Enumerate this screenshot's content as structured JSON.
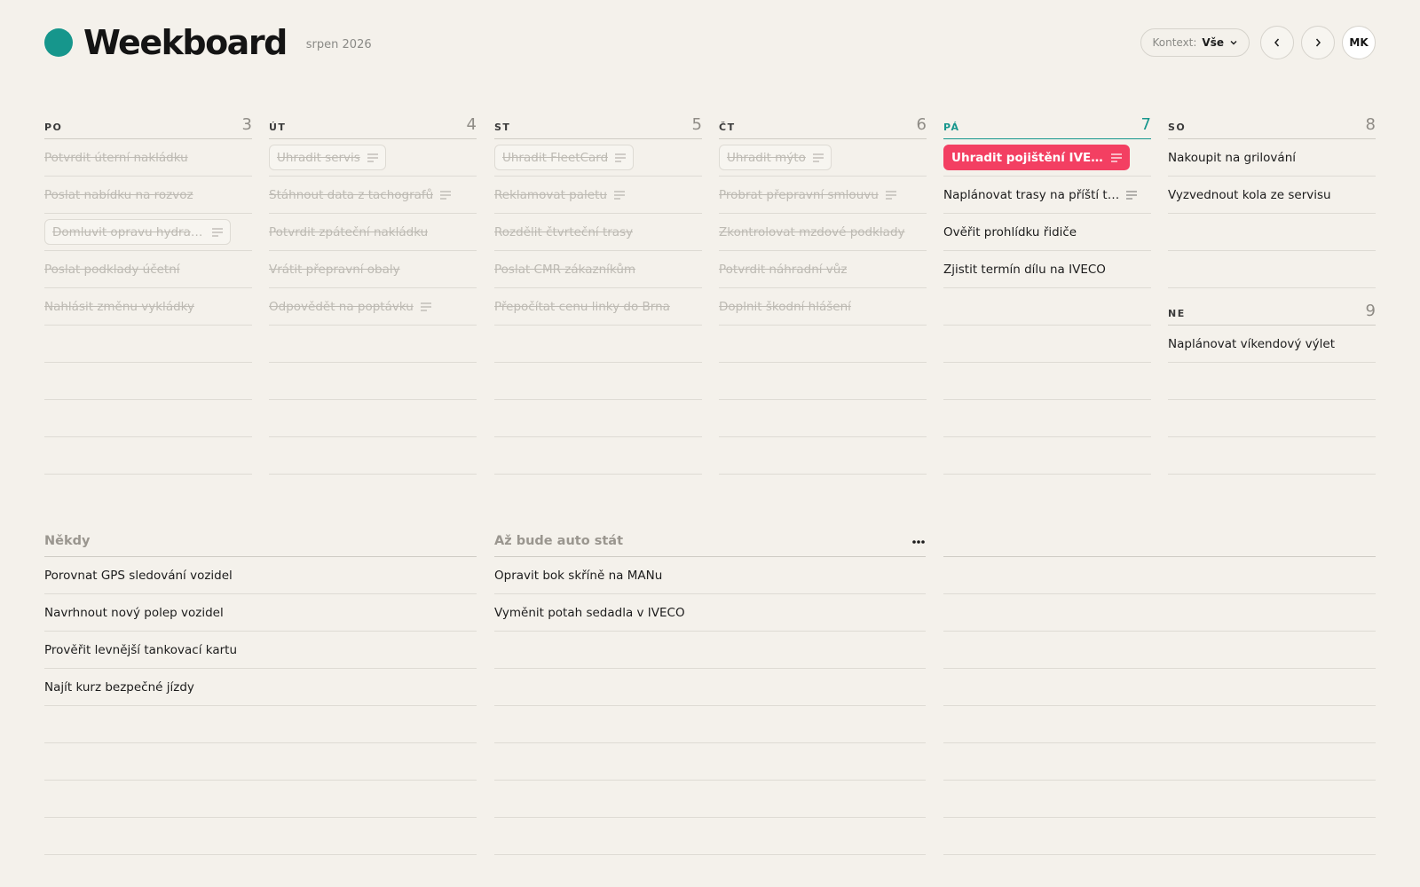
{
  "app": {
    "title": "Weekboard",
    "month": "srpen 2026"
  },
  "header": {
    "context_label": "Kontext:",
    "context_value": "Vše",
    "user_initials": "MK"
  },
  "colors": {
    "accent": "#16968c",
    "hot": "#f33f62",
    "background": "#f4f1eb"
  },
  "days": [
    {
      "name": "PO",
      "num": "3",
      "tasks": [
        {
          "text": "Potvrdit úterní nakládku"
        },
        {
          "text": "Poslat nabídku na rozvoz"
        },
        {
          "text": "Domluvit opravu hydrau…"
        },
        {
          "text": "Poslat podklady účetní"
        },
        {
          "text": "Nahlásit změnu vykládky"
        }
      ]
    },
    {
      "name": "ÚT",
      "num": "4",
      "tasks": [
        {
          "text": "Uhradit servis"
        },
        {
          "text": "Stáhnout data z tachografů"
        },
        {
          "text": "Potvrdit zpáteční nakládku"
        },
        {
          "text": "Vrátit přepravní obaly"
        },
        {
          "text": "Odpovědět na poptávku"
        }
      ]
    },
    {
      "name": "ST",
      "num": "5",
      "tasks": [
        {
          "text": "Uhradit FleetCard"
        },
        {
          "text": "Reklamovat paletu"
        },
        {
          "text": "Rozdělit čtvrteční trasy"
        },
        {
          "text": "Poslat CMR zákazníkům"
        },
        {
          "text": "Přepočítat cenu linky do Brna"
        }
      ]
    },
    {
      "name": "ČT",
      "num": "6",
      "tasks": [
        {
          "text": "Uhradit mýto"
        },
        {
          "text": "Probrat přepravní smlouvu"
        },
        {
          "text": "Zkontrolovat mzdové podklady"
        },
        {
          "text": "Potvrdit náhradní vůz"
        },
        {
          "text": "Doplnit škodní hlášení"
        }
      ]
    },
    {
      "name": "PÁ",
      "num": "7",
      "tasks": [
        {
          "text": "Uhradit pojištění IVECO"
        },
        {
          "text": "Naplánovat trasy na příští t…"
        },
        {
          "text": "Ověřit prohlídku řidiče"
        },
        {
          "text": "Zjistit termín dílu na IVECO"
        }
      ]
    },
    {
      "name": "SO",
      "num": "8",
      "tasks": [
        {
          "text": "Nakoupit na grilování"
        },
        {
          "text": "Vyzvednout kola ze servisu"
        }
      ]
    },
    {
      "name": "NE",
      "num": "9",
      "tasks": [
        {
          "text": "Naplánovat víkendový výlet"
        }
      ]
    }
  ],
  "sections": [
    {
      "title": "Někdy",
      "tasks": [
        {
          "text": "Porovnat GPS sledování vozidel"
        },
        {
          "text": "Navrhnout nový polep vozidel"
        },
        {
          "text": "Prověřit levnější tankovací kartu"
        },
        {
          "text": "Najít kurz bezpečné jízdy"
        }
      ]
    },
    {
      "title": "Až bude auto stát",
      "tasks": [
        {
          "text": "Opravit bok skříně na MANu"
        },
        {
          "text": "Vyměnit potah sedadla v IVECO"
        }
      ]
    },
    {
      "title": "",
      "tasks": []
    }
  ]
}
